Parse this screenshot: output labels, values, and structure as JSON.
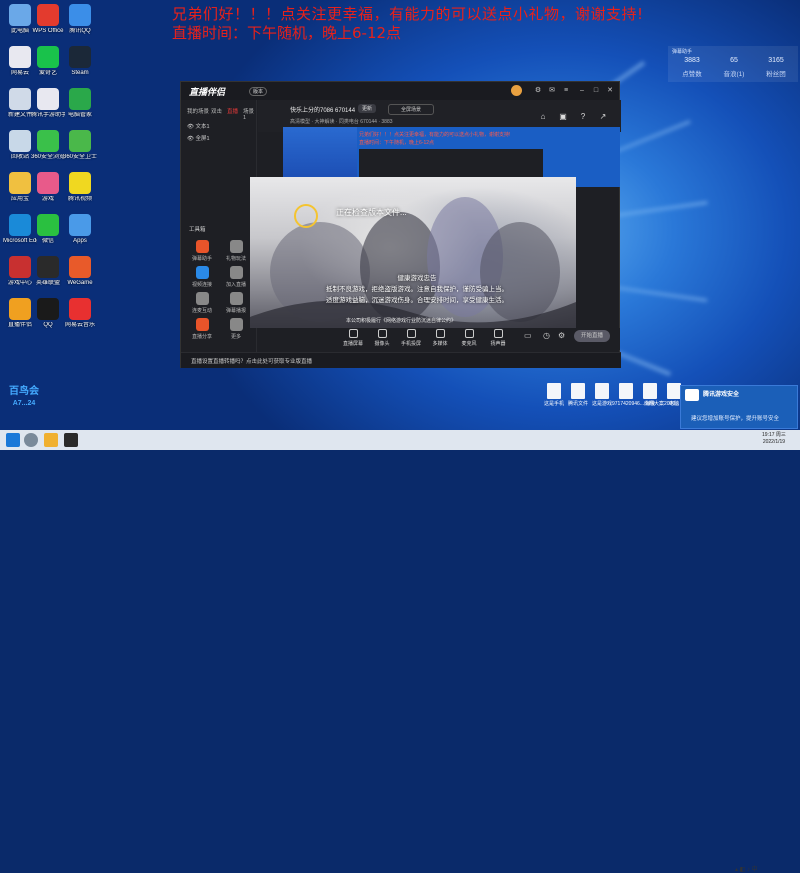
{
  "promo": {
    "line1": "兄弟们好！！！点关注更幸福，有能力的可以送点小礼物，谢谢支持!",
    "line2": "直播时间：下午随机，晚上6-12点"
  },
  "desktop_icons": [
    {
      "label": "此电脑",
      "color": "#6aa8e8"
    },
    {
      "label": "WPS Office",
      "color": "#e33b2e"
    },
    {
      "label": "腾讯QQ",
      "color": "#3b8ee8"
    },
    {
      "label": "网易云",
      "color": "#e8e8f0"
    },
    {
      "label": "爱奇艺",
      "color": "#19c24b"
    },
    {
      "label": "Steam",
      "color": "#1b2838"
    },
    {
      "label": "新建文件",
      "color": "#d0dae8"
    },
    {
      "label": "腾讯手游助手",
      "color": "#e8e8f0"
    },
    {
      "label": "电脑管家",
      "color": "#2aa84a"
    },
    {
      "label": "回收站",
      "color": "#c8d8e8"
    },
    {
      "label": "360安全浏览器",
      "color": "#3ac04a"
    },
    {
      "label": "360安全卫士",
      "color": "#4ab84a"
    },
    {
      "label": "应用宝",
      "color": "#f0c040"
    },
    {
      "label": "游戏",
      "color": "#e85a8a"
    },
    {
      "label": "腾讯视频",
      "color": "#f0d820"
    },
    {
      "label": "Microsoft Edge",
      "color": "#1a8ad8"
    },
    {
      "label": "微信",
      "color": "#2ac040"
    },
    {
      "label": "Apps",
      "color": "#4a9ae8"
    },
    {
      "label": "游戏中心",
      "color": "#c83030"
    },
    {
      "label": "英雄联盟",
      "color": "#2a2a2a"
    },
    {
      "label": "WeGame",
      "color": "#e85a2a"
    },
    {
      "label": "直播伴侣",
      "color": "#f0a020"
    },
    {
      "label": "QQ",
      "color": "#1a1a1a"
    },
    {
      "label": "网易云音乐",
      "color": "#e83030"
    }
  ],
  "stats": {
    "title": "弹幕助手",
    "items": [
      {
        "value": "3883",
        "label": "点赞数"
      },
      {
        "value": "65",
        "label": "音浪(1)"
      },
      {
        "value": "3165",
        "label": "粉丝团"
      }
    ]
  },
  "app": {
    "logo": "直播伴侣",
    "version": "版本",
    "left_tabs": [
      "我的场景",
      "双击",
      "直播",
      "场景1"
    ],
    "scenes": [
      "文本1",
      "全屏1"
    ],
    "tools_heading": "工具箱",
    "tools": [
      {
        "label": "弹幕助手",
        "color": "#e8542a"
      },
      {
        "label": "礼物玩法",
        "color": "#888"
      },
      {
        "label": "视频连接",
        "color": "#2a8ae8"
      },
      {
        "label": "加入直播",
        "color": "#888"
      },
      {
        "label": "连麦互动",
        "color": "#888"
      },
      {
        "label": "弹幕播报",
        "color": "#888"
      },
      {
        "label": "直播分享",
        "color": "#e8542a"
      },
      {
        "label": "更多",
        "color": "#888"
      }
    ],
    "stream_title": "快乐上分的7086 670144",
    "badge": "更新",
    "label_field": "全屏场景",
    "meta": "高清模型 · 大神解读 · 同类电台 670144 · 3883",
    "status": "直播设置直播转播吗？点击此处可获取专业版直播",
    "controls": [
      "直播屏幕",
      "摄像头",
      "手机投屏",
      "多媒体",
      "麦克风",
      "扬声器"
    ],
    "start_label": "开始直播"
  },
  "inner_preview": {
    "line1": "兄弟们好！！！点关注更幸福，有能力的可以送点小礼物，谢谢支持!",
    "line2": "直播时间：下午随机，晚上6-12点"
  },
  "splash": {
    "message": "正在检查版本文件...",
    "health_line1": "健康游戏忠告",
    "health_line2": "抵制不良游戏，拒绝盗版游戏。注意自我保护，谨防受骗上当。",
    "health_line3": "适度游戏益脑，沉迷游戏伤身。合理安排时间，享受健康生活。",
    "footer": "本公司积极履行《网络游戏行业防沉迷自律公约》"
  },
  "desktop_files": [
    "这是手机",
    "腾讯文件",
    "这是游戏",
    "9717420946...南翔大案2020...",
    "海浪",
    "电脑"
  ],
  "notice": {
    "title": "腾讯游戏安全",
    "body": "建议您增加账号保护，提升账号安全"
  },
  "clock": {
    "time": "19:17 周三",
    "date": "2022/1/19"
  },
  "brand_mark": {
    "line1": "百鸟会",
    "line2": "A7...24"
  }
}
